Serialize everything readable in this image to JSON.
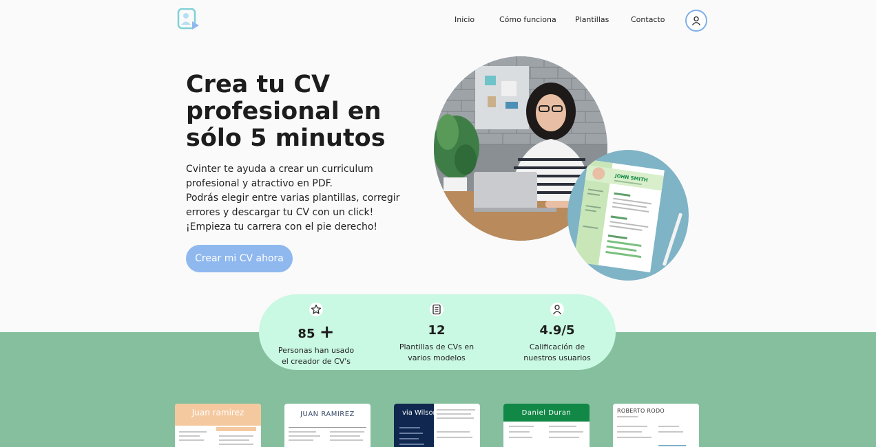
{
  "header": {
    "logo_icon": "profile-play-icon",
    "nav": [
      {
        "label": "Inicio"
      },
      {
        "label": "Cómo funciona"
      },
      {
        "label": "Plantillas"
      },
      {
        "label": "Contacto"
      }
    ],
    "user_icon": "user-icon"
  },
  "hero": {
    "title_lines": [
      "Crea tu CV",
      "profesional en",
      "sólo 5 minutos"
    ],
    "description_lines": [
      "Cvinter te ayuda a crear un curriculum",
      "profesional y atractivo en PDF.",
      "Podrás elegir entre varias plantillas, corregir",
      "errores y descargar tu CV con un click!",
      "¡Empieza tu carrera con el pie derecho!"
    ],
    "cta_label": "Crear mi CV ahora",
    "cv_preview_name": "JOHN SMITH"
  },
  "stats": [
    {
      "icon": "star-icon",
      "value": "85",
      "suffix": "+",
      "label_lines": [
        "Personas han usado",
        "el creador de CV's"
      ]
    },
    {
      "icon": "document-icon",
      "value": "12",
      "suffix": "",
      "label_lines": [
        "Plantillas de CVs en",
        "varios modelos"
      ]
    },
    {
      "icon": "user-icon",
      "value": "4.9/5",
      "suffix": "",
      "label_lines": [
        "Calificación de",
        "nuestros usuarios"
      ]
    }
  ],
  "templates": [
    {
      "name": "Juan ramirez",
      "accent": "#f5c9a0"
    },
    {
      "name": "JUAN RAMIREZ",
      "accent": "#ffffff"
    },
    {
      "name": "via Wilson",
      "accent": "#10284f"
    },
    {
      "name": "Daniel Duran",
      "accent": "#128847"
    },
    {
      "name": "ROBERTO RODO",
      "accent": "#ffffff"
    }
  ],
  "colors": {
    "accent": "#8fb8ee",
    "band": "#86bf9e",
    "stats_bg": "#c9f8e3"
  }
}
